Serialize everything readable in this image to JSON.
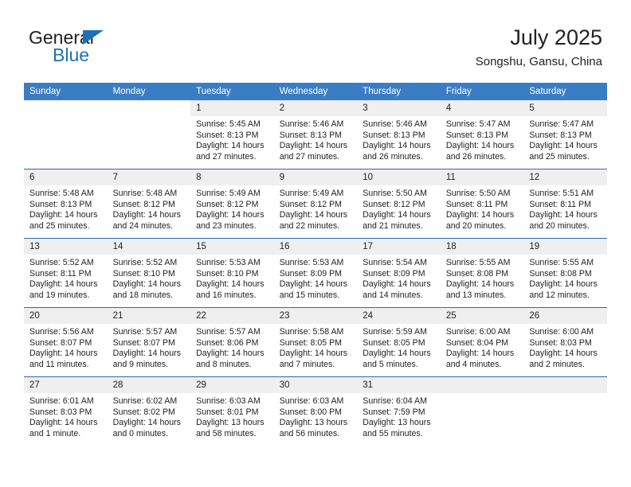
{
  "brand": {
    "name_part1": "General",
    "name_part2": "Blue",
    "triangle_color": "#1b72b8"
  },
  "header": {
    "title": "July 2025",
    "subtitle": "Songshu, Gansu, China"
  },
  "theme": {
    "header_bg": "#3b7dc4",
    "header_text": "#ffffff",
    "row_divider": "#2f6aa8",
    "daynum_bg": "#efefef",
    "cell_bg": "#ffffff"
  },
  "weekdays": [
    "Sunday",
    "Monday",
    "Tuesday",
    "Wednesday",
    "Thursday",
    "Friday",
    "Saturday"
  ],
  "weeks": [
    [
      {
        "day": "",
        "blank": true,
        "lines": []
      },
      {
        "day": "",
        "blank": true,
        "lines": []
      },
      {
        "day": "1",
        "lines": [
          "Sunrise: 5:45 AM",
          "Sunset: 8:13 PM",
          "Daylight: 14 hours",
          "and 27 minutes."
        ]
      },
      {
        "day": "2",
        "lines": [
          "Sunrise: 5:46 AM",
          "Sunset: 8:13 PM",
          "Daylight: 14 hours",
          "and 27 minutes."
        ]
      },
      {
        "day": "3",
        "lines": [
          "Sunrise: 5:46 AM",
          "Sunset: 8:13 PM",
          "Daylight: 14 hours",
          "and 26 minutes."
        ]
      },
      {
        "day": "4",
        "lines": [
          "Sunrise: 5:47 AM",
          "Sunset: 8:13 PM",
          "Daylight: 14 hours",
          "and 26 minutes."
        ]
      },
      {
        "day": "5",
        "lines": [
          "Sunrise: 5:47 AM",
          "Sunset: 8:13 PM",
          "Daylight: 14 hours",
          "and 25 minutes."
        ]
      }
    ],
    [
      {
        "day": "6",
        "lines": [
          "Sunrise: 5:48 AM",
          "Sunset: 8:13 PM",
          "Daylight: 14 hours",
          "and 25 minutes."
        ]
      },
      {
        "day": "7",
        "lines": [
          "Sunrise: 5:48 AM",
          "Sunset: 8:12 PM",
          "Daylight: 14 hours",
          "and 24 minutes."
        ]
      },
      {
        "day": "8",
        "lines": [
          "Sunrise: 5:49 AM",
          "Sunset: 8:12 PM",
          "Daylight: 14 hours",
          "and 23 minutes."
        ]
      },
      {
        "day": "9",
        "lines": [
          "Sunrise: 5:49 AM",
          "Sunset: 8:12 PM",
          "Daylight: 14 hours",
          "and 22 minutes."
        ]
      },
      {
        "day": "10",
        "lines": [
          "Sunrise: 5:50 AM",
          "Sunset: 8:12 PM",
          "Daylight: 14 hours",
          "and 21 minutes."
        ]
      },
      {
        "day": "11",
        "lines": [
          "Sunrise: 5:50 AM",
          "Sunset: 8:11 PM",
          "Daylight: 14 hours",
          "and 20 minutes."
        ]
      },
      {
        "day": "12",
        "lines": [
          "Sunrise: 5:51 AM",
          "Sunset: 8:11 PM",
          "Daylight: 14 hours",
          "and 20 minutes."
        ]
      }
    ],
    [
      {
        "day": "13",
        "lines": [
          "Sunrise: 5:52 AM",
          "Sunset: 8:11 PM",
          "Daylight: 14 hours",
          "and 19 minutes."
        ]
      },
      {
        "day": "14",
        "lines": [
          "Sunrise: 5:52 AM",
          "Sunset: 8:10 PM",
          "Daylight: 14 hours",
          "and 18 minutes."
        ]
      },
      {
        "day": "15",
        "lines": [
          "Sunrise: 5:53 AM",
          "Sunset: 8:10 PM",
          "Daylight: 14 hours",
          "and 16 minutes."
        ]
      },
      {
        "day": "16",
        "lines": [
          "Sunrise: 5:53 AM",
          "Sunset: 8:09 PM",
          "Daylight: 14 hours",
          "and 15 minutes."
        ]
      },
      {
        "day": "17",
        "lines": [
          "Sunrise: 5:54 AM",
          "Sunset: 8:09 PM",
          "Daylight: 14 hours",
          "and 14 minutes."
        ]
      },
      {
        "day": "18",
        "lines": [
          "Sunrise: 5:55 AM",
          "Sunset: 8:08 PM",
          "Daylight: 14 hours",
          "and 13 minutes."
        ]
      },
      {
        "day": "19",
        "lines": [
          "Sunrise: 5:55 AM",
          "Sunset: 8:08 PM",
          "Daylight: 14 hours",
          "and 12 minutes."
        ]
      }
    ],
    [
      {
        "day": "20",
        "lines": [
          "Sunrise: 5:56 AM",
          "Sunset: 8:07 PM",
          "Daylight: 14 hours",
          "and 11 minutes."
        ]
      },
      {
        "day": "21",
        "lines": [
          "Sunrise: 5:57 AM",
          "Sunset: 8:07 PM",
          "Daylight: 14 hours",
          "and 9 minutes."
        ]
      },
      {
        "day": "22",
        "lines": [
          "Sunrise: 5:57 AM",
          "Sunset: 8:06 PM",
          "Daylight: 14 hours",
          "and 8 minutes."
        ]
      },
      {
        "day": "23",
        "lines": [
          "Sunrise: 5:58 AM",
          "Sunset: 8:05 PM",
          "Daylight: 14 hours",
          "and 7 minutes."
        ]
      },
      {
        "day": "24",
        "lines": [
          "Sunrise: 5:59 AM",
          "Sunset: 8:05 PM",
          "Daylight: 14 hours",
          "and 5 minutes."
        ]
      },
      {
        "day": "25",
        "lines": [
          "Sunrise: 6:00 AM",
          "Sunset: 8:04 PM",
          "Daylight: 14 hours",
          "and 4 minutes."
        ]
      },
      {
        "day": "26",
        "lines": [
          "Sunrise: 6:00 AM",
          "Sunset: 8:03 PM",
          "Daylight: 14 hours",
          "and 2 minutes."
        ]
      }
    ],
    [
      {
        "day": "27",
        "lines": [
          "Sunrise: 6:01 AM",
          "Sunset: 8:03 PM",
          "Daylight: 14 hours",
          "and 1 minute."
        ]
      },
      {
        "day": "28",
        "lines": [
          "Sunrise: 6:02 AM",
          "Sunset: 8:02 PM",
          "Daylight: 14 hours",
          "and 0 minutes."
        ]
      },
      {
        "day": "29",
        "lines": [
          "Sunrise: 6:03 AM",
          "Sunset: 8:01 PM",
          "Daylight: 13 hours",
          "and 58 minutes."
        ]
      },
      {
        "day": "30",
        "lines": [
          "Sunrise: 6:03 AM",
          "Sunset: 8:00 PM",
          "Daylight: 13 hours",
          "and 56 minutes."
        ]
      },
      {
        "day": "31",
        "lines": [
          "Sunrise: 6:04 AM",
          "Sunset: 7:59 PM",
          "Daylight: 13 hours",
          "and 55 minutes."
        ]
      },
      {
        "day": "",
        "empty": true,
        "lines": []
      },
      {
        "day": "",
        "empty": true,
        "lines": []
      }
    ]
  ]
}
